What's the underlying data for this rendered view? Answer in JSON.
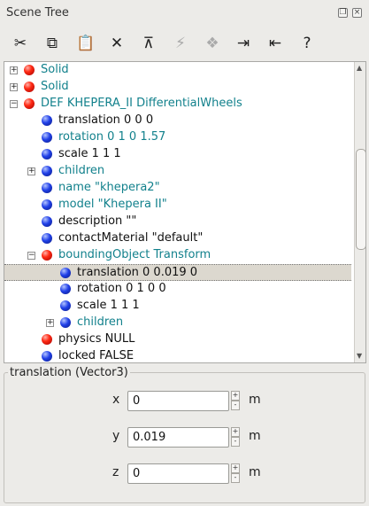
{
  "window": {
    "title": "Scene Tree"
  },
  "titlebar_buttons": [
    "restore-icon",
    "close-icon"
  ],
  "toolbar": [
    {
      "name": "cut-icon",
      "glyph": "✂",
      "disabled": false
    },
    {
      "name": "copy-icon",
      "glyph": "⧉",
      "disabled": false
    },
    {
      "name": "paste-icon",
      "glyph": "📋",
      "disabled": false
    },
    {
      "name": "delete-icon",
      "glyph": "✕",
      "disabled": false
    },
    {
      "name": "reset-to-default-icon",
      "glyph": "⊼",
      "disabled": false
    },
    {
      "name": "transform-icon",
      "glyph": "⚡",
      "disabled": true
    },
    {
      "name": "insert-after-icon",
      "glyph": "❖",
      "disabled": true
    },
    {
      "name": "import-icon",
      "glyph": "⇥",
      "disabled": false
    },
    {
      "name": "export-icon",
      "glyph": "⇤",
      "disabled": false
    },
    {
      "name": "help-icon",
      "glyph": "?",
      "disabled": false
    }
  ],
  "tree": {
    "rows": [
      {
        "label": "Solid",
        "ball": "red",
        "style": "link",
        "expander": "+",
        "level": 0
      },
      {
        "label": "Solid",
        "ball": "red",
        "style": "link",
        "expander": "+",
        "level": 0
      },
      {
        "label": "DEF KHEPERA_II DifferentialWheels",
        "ball": "red",
        "style": "link",
        "expander": "−",
        "level": 0
      },
      {
        "label": "translation 0 0 0",
        "ball": "blue",
        "style": "plain",
        "expander": "",
        "level": 1
      },
      {
        "label": "rotation 0 1 0 1.57",
        "ball": "blue",
        "style": "link",
        "expander": "",
        "level": 1
      },
      {
        "label": "scale 1 1 1",
        "ball": "blue",
        "style": "plain",
        "expander": "",
        "level": 1
      },
      {
        "label": "children",
        "ball": "blue",
        "style": "link",
        "expander": "+",
        "level": 1
      },
      {
        "label": "name \"khepera2\"",
        "ball": "blue",
        "style": "link",
        "expander": "",
        "level": 1
      },
      {
        "label": "model \"Khepera II\"",
        "ball": "blue",
        "style": "link",
        "expander": "",
        "level": 1
      },
      {
        "label": "description \"\"",
        "ball": "blue",
        "style": "plain",
        "expander": "",
        "level": 1
      },
      {
        "label": "contactMaterial \"default\"",
        "ball": "blue",
        "style": "plain",
        "expander": "",
        "level": 1
      },
      {
        "label": "boundingObject Transform",
        "ball": "red",
        "style": "link",
        "expander": "−",
        "level": 1
      },
      {
        "label": "translation 0 0.019 0",
        "ball": "blue",
        "style": "plain",
        "expander": "",
        "level": 2,
        "selected": true
      },
      {
        "label": "rotation 0 1 0 0",
        "ball": "blue",
        "style": "plain",
        "expander": "",
        "level": 2
      },
      {
        "label": "scale 1 1 1",
        "ball": "blue",
        "style": "plain",
        "expander": "",
        "level": 2
      },
      {
        "label": "children",
        "ball": "blue",
        "style": "link",
        "expander": "+",
        "level": 2
      },
      {
        "label": "physics NULL",
        "ball": "red",
        "style": "plain",
        "expander": "",
        "level": 1
      },
      {
        "label": "locked FALSE",
        "ball": "blue",
        "style": "plain",
        "expander": "",
        "level": 1
      }
    ]
  },
  "properties": {
    "title": "translation (Vector3)",
    "fields": [
      {
        "axis": "x",
        "value": "0",
        "unit": "m"
      },
      {
        "axis": "y",
        "value": "0.019",
        "unit": "m"
      },
      {
        "axis": "z",
        "value": "0",
        "unit": "m"
      }
    ],
    "stepper_up": "+",
    "stepper_down": "-"
  },
  "colors": {
    "link_text": "#12818c",
    "selection": "#dcd8cf",
    "background": "#ecebe8"
  }
}
